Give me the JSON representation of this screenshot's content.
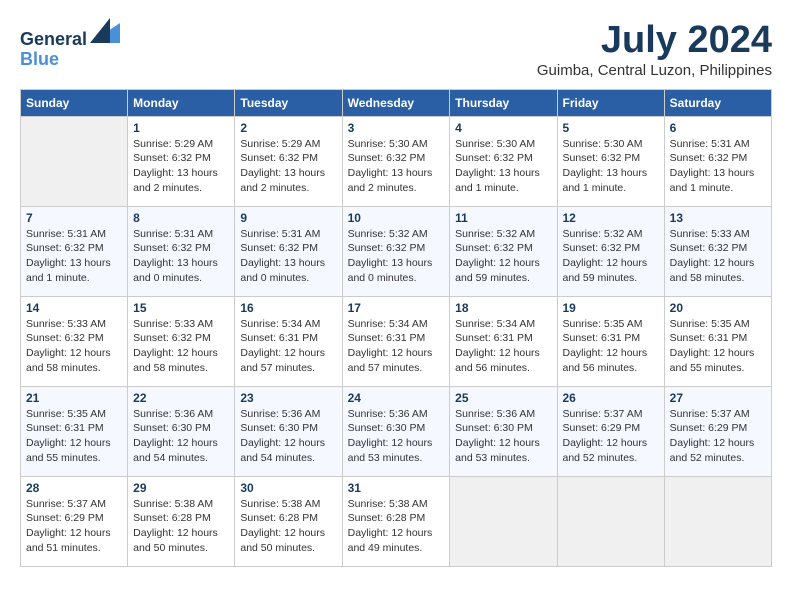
{
  "header": {
    "logo_line1": "General",
    "logo_line2": "Blue",
    "month_year": "July 2024",
    "location": "Guimba, Central Luzon, Philippines"
  },
  "calendar": {
    "weekdays": [
      "Sunday",
      "Monday",
      "Tuesday",
      "Wednesday",
      "Thursday",
      "Friday",
      "Saturday"
    ],
    "weeks": [
      [
        {
          "day": "",
          "info": ""
        },
        {
          "day": "1",
          "info": "Sunrise: 5:29 AM\nSunset: 6:32 PM\nDaylight: 13 hours\nand 2 minutes."
        },
        {
          "day": "2",
          "info": "Sunrise: 5:29 AM\nSunset: 6:32 PM\nDaylight: 13 hours\nand 2 minutes."
        },
        {
          "day": "3",
          "info": "Sunrise: 5:30 AM\nSunset: 6:32 PM\nDaylight: 13 hours\nand 2 minutes."
        },
        {
          "day": "4",
          "info": "Sunrise: 5:30 AM\nSunset: 6:32 PM\nDaylight: 13 hours\nand 1 minute."
        },
        {
          "day": "5",
          "info": "Sunrise: 5:30 AM\nSunset: 6:32 PM\nDaylight: 13 hours\nand 1 minute."
        },
        {
          "day": "6",
          "info": "Sunrise: 5:31 AM\nSunset: 6:32 PM\nDaylight: 13 hours\nand 1 minute."
        }
      ],
      [
        {
          "day": "7",
          "info": "Sunrise: 5:31 AM\nSunset: 6:32 PM\nDaylight: 13 hours\nand 1 minute."
        },
        {
          "day": "8",
          "info": "Sunrise: 5:31 AM\nSunset: 6:32 PM\nDaylight: 13 hours\nand 0 minutes."
        },
        {
          "day": "9",
          "info": "Sunrise: 5:31 AM\nSunset: 6:32 PM\nDaylight: 13 hours\nand 0 minutes."
        },
        {
          "day": "10",
          "info": "Sunrise: 5:32 AM\nSunset: 6:32 PM\nDaylight: 13 hours\nand 0 minutes."
        },
        {
          "day": "11",
          "info": "Sunrise: 5:32 AM\nSunset: 6:32 PM\nDaylight: 12 hours\nand 59 minutes."
        },
        {
          "day": "12",
          "info": "Sunrise: 5:32 AM\nSunset: 6:32 PM\nDaylight: 12 hours\nand 59 minutes."
        },
        {
          "day": "13",
          "info": "Sunrise: 5:33 AM\nSunset: 6:32 PM\nDaylight: 12 hours\nand 58 minutes."
        }
      ],
      [
        {
          "day": "14",
          "info": "Sunrise: 5:33 AM\nSunset: 6:32 PM\nDaylight: 12 hours\nand 58 minutes."
        },
        {
          "day": "15",
          "info": "Sunrise: 5:33 AM\nSunset: 6:32 PM\nDaylight: 12 hours\nand 58 minutes."
        },
        {
          "day": "16",
          "info": "Sunrise: 5:34 AM\nSunset: 6:31 PM\nDaylight: 12 hours\nand 57 minutes."
        },
        {
          "day": "17",
          "info": "Sunrise: 5:34 AM\nSunset: 6:31 PM\nDaylight: 12 hours\nand 57 minutes."
        },
        {
          "day": "18",
          "info": "Sunrise: 5:34 AM\nSunset: 6:31 PM\nDaylight: 12 hours\nand 56 minutes."
        },
        {
          "day": "19",
          "info": "Sunrise: 5:35 AM\nSunset: 6:31 PM\nDaylight: 12 hours\nand 56 minutes."
        },
        {
          "day": "20",
          "info": "Sunrise: 5:35 AM\nSunset: 6:31 PM\nDaylight: 12 hours\nand 55 minutes."
        }
      ],
      [
        {
          "day": "21",
          "info": "Sunrise: 5:35 AM\nSunset: 6:31 PM\nDaylight: 12 hours\nand 55 minutes."
        },
        {
          "day": "22",
          "info": "Sunrise: 5:36 AM\nSunset: 6:30 PM\nDaylight: 12 hours\nand 54 minutes."
        },
        {
          "day": "23",
          "info": "Sunrise: 5:36 AM\nSunset: 6:30 PM\nDaylight: 12 hours\nand 54 minutes."
        },
        {
          "day": "24",
          "info": "Sunrise: 5:36 AM\nSunset: 6:30 PM\nDaylight: 12 hours\nand 53 minutes."
        },
        {
          "day": "25",
          "info": "Sunrise: 5:36 AM\nSunset: 6:30 PM\nDaylight: 12 hours\nand 53 minutes."
        },
        {
          "day": "26",
          "info": "Sunrise: 5:37 AM\nSunset: 6:29 PM\nDaylight: 12 hours\nand 52 minutes."
        },
        {
          "day": "27",
          "info": "Sunrise: 5:37 AM\nSunset: 6:29 PM\nDaylight: 12 hours\nand 52 minutes."
        }
      ],
      [
        {
          "day": "28",
          "info": "Sunrise: 5:37 AM\nSunset: 6:29 PM\nDaylight: 12 hours\nand 51 minutes."
        },
        {
          "day": "29",
          "info": "Sunrise: 5:38 AM\nSunset: 6:28 PM\nDaylight: 12 hours\nand 50 minutes."
        },
        {
          "day": "30",
          "info": "Sunrise: 5:38 AM\nSunset: 6:28 PM\nDaylight: 12 hours\nand 50 minutes."
        },
        {
          "day": "31",
          "info": "Sunrise: 5:38 AM\nSunset: 6:28 PM\nDaylight: 12 hours\nand 49 minutes."
        },
        {
          "day": "",
          "info": ""
        },
        {
          "day": "",
          "info": ""
        },
        {
          "day": "",
          "info": ""
        }
      ]
    ]
  }
}
